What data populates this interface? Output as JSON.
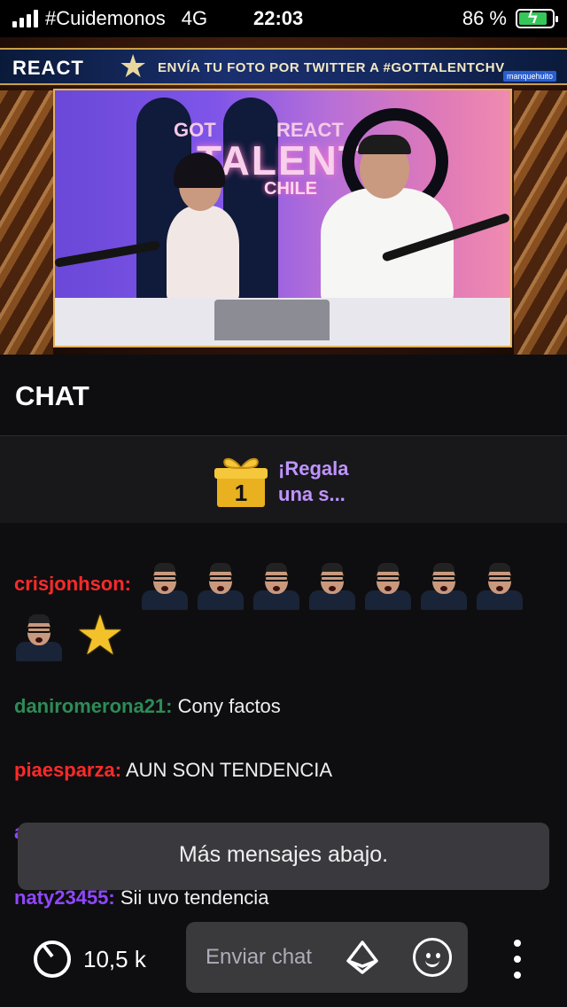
{
  "status_bar": {
    "carrier": "#Cuidemonos",
    "network": "4G",
    "time": "22:03",
    "battery": "86 %",
    "battery_level": 0.86
  },
  "video": {
    "banner_left": "REACT",
    "banner_text": "ENVÍA TU FOTO POR TWITTER A #GOTTALENTCHV",
    "banner_tag": "manquehuito",
    "logo_got": "GOT",
    "logo_react": "REACT",
    "logo_talent": "TALENT",
    "logo_chile": "CHILE"
  },
  "chat": {
    "title": "CHAT",
    "gift_text_line1": "¡Regala",
    "gift_text_line2": "una s...",
    "gift_badge": "1",
    "messages": [
      {
        "user": "crisjonhson:",
        "text": "",
        "color": "#ff2a2a"
      },
      {
        "user": "daniromerona21:",
        "text": "Cony factos",
        "color": "#2e8b57"
      },
      {
        "user": "piaesparza:",
        "text": "AUN SON TENDENCIA",
        "color": "#ff2a2a"
      },
      {
        "user": "a",
        "text": "",
        "color": "#9147ff"
      },
      {
        "user": "naty23455:",
        "text": "Sii uvo tendencia",
        "color": "#9147ff"
      }
    ],
    "toast": "Más mensajes abajo."
  },
  "bottom_bar": {
    "viewer_count": "10,5 k",
    "chat_placeholder": "Enviar chat"
  },
  "colors": {
    "background": "#0e0e10",
    "accent_purple": "#bf94ff",
    "input_bg": "#3a3a3d"
  }
}
